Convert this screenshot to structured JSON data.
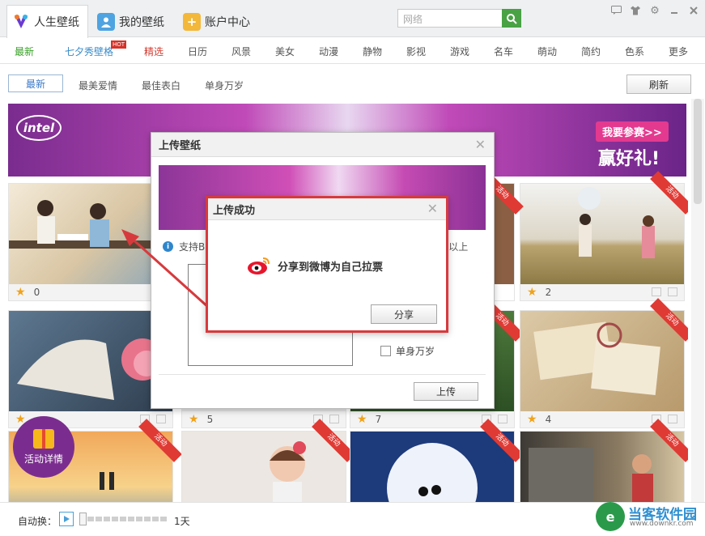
{
  "tabs": [
    {
      "label": "人生壁纸",
      "icon": "app-logo-icon"
    },
    {
      "label": "我的壁纸",
      "icon": "user-icon"
    },
    {
      "label": "账户中心",
      "icon": "plus-icon"
    }
  ],
  "search": {
    "placeholder": "网络"
  },
  "categories": [
    "最新",
    "七夕秀壁格",
    "精选",
    "日历",
    "风景",
    "美女",
    "动漫",
    "静物",
    "影视",
    "游戏",
    "名车",
    "萌动",
    "简约",
    "色系",
    "更多"
  ],
  "hot_badge": "HOT",
  "subtabs": [
    "最新",
    "最美爱情",
    "最佳表白",
    "单身万岁"
  ],
  "refresh_label": "刷新",
  "banner": {
    "brand": "intel",
    "join": "我要参赛>>",
    "prize": "赢好礼!"
  },
  "ribbon": "活动",
  "cards": [
    {
      "count": "0"
    },
    {
      "count": "2"
    },
    {
      "count": ""
    },
    {
      "count": "5"
    },
    {
      "count": "7"
    },
    {
      "count": "4"
    }
  ],
  "activity_label": "活动详情",
  "bottom": {
    "auto_label": "自动换：",
    "duration": "1天"
  },
  "watermark": {
    "title": "当客软件园",
    "url": "www.downkr.com"
  },
  "upload_dialog": {
    "title": "上传壁纸",
    "info_prefix": "支持B",
    "size_suffix": "68以上",
    "checkbox_label": "单身万岁",
    "upload_button": "上传"
  },
  "success_dialog": {
    "title": "上传成功",
    "message": "分享到微博为自己拉票",
    "share_button": "分享"
  },
  "colors": {
    "green": "#3aa02a",
    "red_border": "#d73a3d",
    "accent_blue": "#2f86cc",
    "banner_purple": "#7a2c8e"
  }
}
